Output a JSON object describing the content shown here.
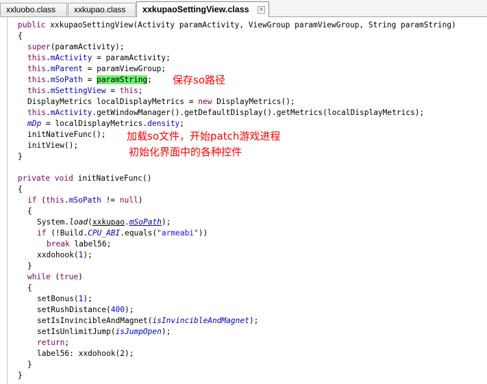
{
  "tabs": [
    {
      "label": "xxluobo.class",
      "active": false
    },
    {
      "label": "xxkupao.class",
      "active": false
    },
    {
      "label": "xxkupaoSettingView.class",
      "active": true
    }
  ],
  "code": {
    "ctor_sig": {
      "kw": "public",
      "text": " xxkupaoSettingView(Activity paramActivity, ViewGroup paramViewGroup, String paramString)"
    },
    "brace_open": "{",
    "brace_close": "}",
    "super_call": {
      "kw": "super",
      "text": "(paramActivity);"
    },
    "assign_activity": {
      "kw": "this",
      "field": "mActivity",
      "text": " = paramActivity;"
    },
    "assign_parent": {
      "kw": "this",
      "field": "mParent",
      "text": " = paramViewGroup;"
    },
    "assign_sopath": {
      "kw": "this",
      "field": "mSoPath",
      "eq": " = ",
      "param": "paramString",
      "end": ";"
    },
    "assign_settingview": {
      "kw": "this",
      "field": "mSettingView",
      "eq": " = ",
      "kw2": "this",
      "end": ";"
    },
    "metrics_decl": {
      "pre": "DisplayMetrics localDisplayMetrics = ",
      "kw": "new",
      "post": " DisplayMetrics();"
    },
    "metrics_call": {
      "kw": "this",
      "field": "mActivity",
      "text": ".getWindowManager().getDefaultDisplay().getMetrics(localDisplayMetrics);"
    },
    "mdp_assign": {
      "field": "mDp",
      "pre": " = localDisplayMetrics.",
      "field2": "density",
      "end": ";"
    },
    "init_native_call": "initNativeFunc();",
    "init_view_call": "initView();",
    "method_sig": {
      "kw": "private",
      "kw2": "void",
      "text": " initNativeFunc()"
    },
    "if_sopath": {
      "kw": "if",
      "open": " (",
      "kw2": "this",
      "field": "mSoPath",
      "mid": " != ",
      "kw3": "null",
      "close": ")"
    },
    "system_load": {
      "pre": "System.",
      "method": "load",
      "open": "(",
      "cls": "xxkupao",
      "dot": ".",
      "field": "mSoPath",
      "end": ");"
    },
    "if_abi": {
      "kw": "if",
      "pre": " (!Build.",
      "field": "CPU_ABI",
      "mid": ".equals(",
      "str": "\"armeabi\"",
      "end": "))"
    },
    "break_stmt": {
      "kw": "break",
      "text": " label56;"
    },
    "hook1": {
      "pre": "xxdohook(",
      "num": "1",
      "end": ");"
    },
    "while_stmt": {
      "kw": "while",
      "open": " (",
      "kw2": "true",
      "close": ")"
    },
    "set_bonus": {
      "pre": "setBonus(",
      "num": "1",
      "end": ");"
    },
    "set_rush": {
      "pre": "setRushDistance(",
      "num": "400",
      "end": ");"
    },
    "set_invincible": {
      "pre": "setIsInvincibleAndMagnet(",
      "arg": "isInvincibleAndMagnet",
      "end": ");"
    },
    "set_jump": {
      "pre": "setIsUnlimitJump(",
      "arg": "isJumpOpen",
      "end": ");"
    },
    "return_stmt": {
      "kw": "return",
      "end": ";"
    },
    "label56": {
      "text": "label56: xxdohook(2);"
    }
  },
  "annotations": {
    "save_path": "保存so路径",
    "load_so": "加载so文件，开始patch游戏进程",
    "init_ui": "初始化界面中的各种控件"
  },
  "colors": {
    "keyword": "#7f0055",
    "field": "#0000c0",
    "string": "#2a00ff",
    "highlight": "#6ff06f",
    "annotation": "#ff0000"
  }
}
